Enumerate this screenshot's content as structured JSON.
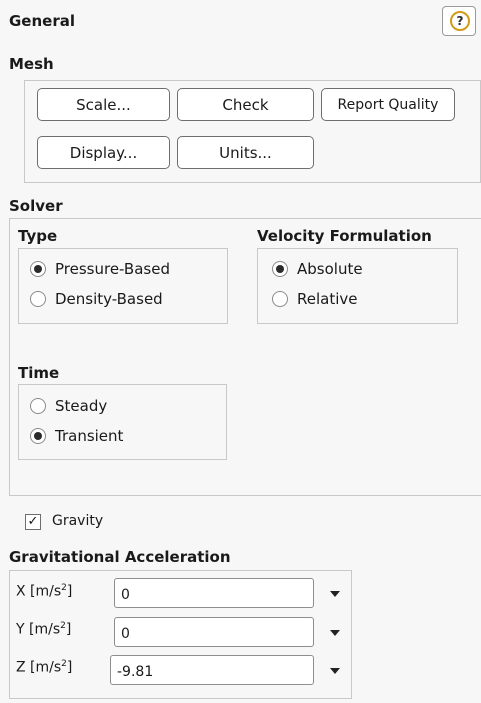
{
  "panel": {
    "title": "General",
    "help_icon": "help-icon",
    "help_glyph": "?"
  },
  "mesh": {
    "label": "Mesh",
    "buttons": {
      "scale": "Scale...",
      "check": "Check",
      "report_quality": "Report Quality",
      "display": "Display...",
      "units": "Units..."
    }
  },
  "solver": {
    "label": "Solver",
    "type": {
      "label": "Type",
      "options": [
        {
          "label": "Pressure-Based",
          "selected": true
        },
        {
          "label": "Density-Based",
          "selected": false
        }
      ]
    },
    "velocity": {
      "label": "Velocity Formulation",
      "options": [
        {
          "label": "Absolute",
          "selected": true
        },
        {
          "label": "Relative",
          "selected": false
        }
      ]
    },
    "time": {
      "label": "Time",
      "options": [
        {
          "label": "Steady",
          "selected": false
        },
        {
          "label": "Transient",
          "selected": true
        }
      ]
    }
  },
  "gravity": {
    "checkbox_label": "Gravity",
    "checked": true,
    "check_glyph": "✓",
    "acceleration_label": "Gravitational Acceleration",
    "fields": [
      {
        "axis": "X",
        "unit": "[m/s",
        "unit_sup": "2",
        "unit_close": "]",
        "value": "0"
      },
      {
        "axis": "Y",
        "unit": "[m/s",
        "unit_sup": "2",
        "unit_close": "]",
        "value": "0"
      },
      {
        "axis": "Z",
        "unit": "[m/s",
        "unit_sup": "2",
        "unit_close": "]",
        "value": "-9.81"
      }
    ]
  },
  "colors": {
    "help_ring": "#d49a1a",
    "border": "#c8c8c8",
    "background": "#f7f7f7"
  }
}
